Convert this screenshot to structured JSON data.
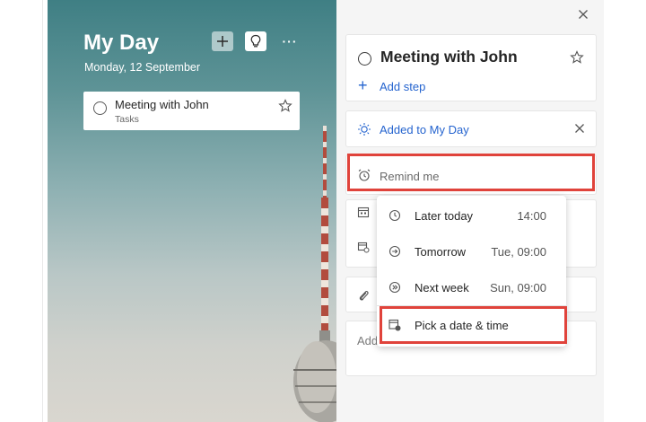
{
  "list": {
    "title": "My Day",
    "date": "Monday, 12 September",
    "more_label": "···",
    "tasks": [
      {
        "title": "Meeting with John",
        "list_name": "Tasks"
      }
    ]
  },
  "detail": {
    "task_title": "Meeting with John",
    "add_step_label": "Add step",
    "added_to_my_day_label": "Added to My Day",
    "remind_me_placeholder": "Remind me",
    "note_placeholder": "Add note"
  },
  "remind_menu": {
    "items": [
      {
        "label": "Later today",
        "time": "14:00",
        "icon": "clock-icon"
      },
      {
        "label": "Tomorrow",
        "time": "Tue, 09:00",
        "icon": "arrow-right-circle-icon"
      },
      {
        "label": "Next week",
        "time": "Sun, 09:00",
        "icon": "double-chevron-circle-icon"
      },
      {
        "label": "Pick a date & time",
        "icon": "calendar-clock-icon"
      }
    ]
  },
  "colors": {
    "accent": "#2564cf",
    "highlight": "#e0433b"
  }
}
